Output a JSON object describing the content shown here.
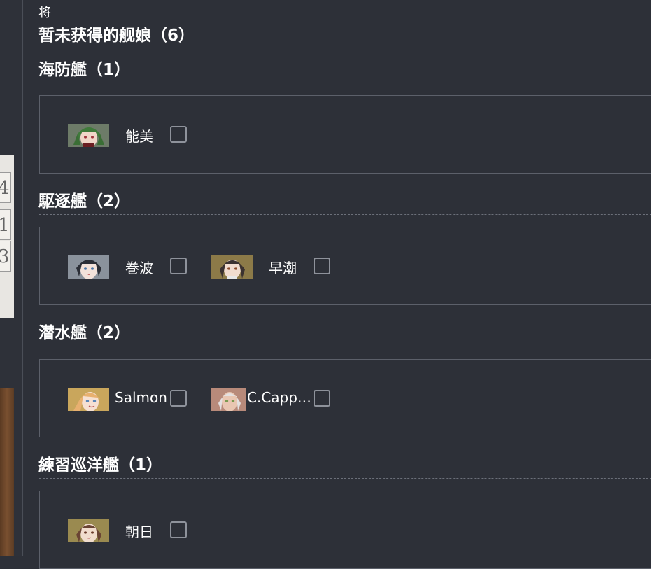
{
  "background": {
    "left_card_digits": [
      "4",
      "1",
      "3"
    ]
  },
  "header": {
    "small_text": "将",
    "title": "暂未获得的舰娘（6）"
  },
  "sections": [
    {
      "title": "海防艦（1）",
      "ships": [
        {
          "name": "能美",
          "icon": "portrait-green-hair",
          "checked": false
        }
      ]
    },
    {
      "title": "駆逐艦（2）",
      "ships": [
        {
          "name": "巻波",
          "icon": "portrait-dark-hair",
          "checked": false
        },
        {
          "name": "早潮",
          "icon": "portrait-brown-hair",
          "checked": false
        }
      ]
    },
    {
      "title": "潜水艦（2）",
      "ships": [
        {
          "name": "Salmon",
          "icon": "portrait-blonde-hair",
          "checked": false
        },
        {
          "name": "C.Capp…",
          "icon": "portrait-silver-hair",
          "checked": false
        }
      ]
    },
    {
      "title": "練習巡洋艦（1）",
      "ships": [
        {
          "name": "朝日",
          "icon": "portrait-auburn-hair",
          "checked": false
        }
      ]
    }
  ],
  "colors": {
    "background": "#2d3038",
    "border": "#5c606a",
    "text": "#ffffff"
  }
}
